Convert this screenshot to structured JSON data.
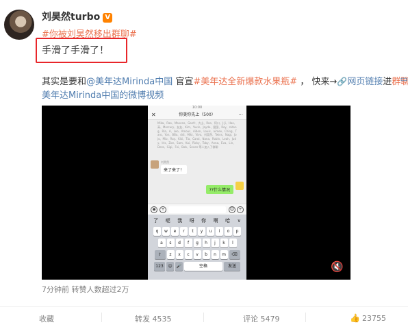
{
  "post": {
    "username": "刘昊然turbo",
    "verified_badge": "V",
    "topic": "#你被刘昊然移出群聊#",
    "text": "手滑了手滑了！",
    "body_line1_a": "其实是要和",
    "body_mention": "@美年达Mirinda中国",
    "body_line1_b": " 官宣",
    "body_topic": "#美年达全新爆款水果瓶#",
    "body_line1_c": " ， 快来→",
    "body_link_icon": "🔗",
    "body_link": "网页链接",
    "body_line1_d": "进",
    "body_group": "群聊",
    "body_line1_e": "！",
    "body_line2": "美年达Mirinda中国的微博视频",
    "meta": "7分钟前 转赞人数超过2万"
  },
  "video": {
    "mute_icon": "mute-icon",
    "phone": {
      "time": "10:00",
      "chat_title": "你美你先上（500）",
      "close": "✕",
      "more": "···",
      "notice": "Mika、Rao、Mavens、Ganfr、大山、Reo、阿川、J-Ji、Hao、高、Mercury、友友、Kim、Yuxin、Jayde、图图、Roy、zidong、Ria、A、Leo、Amour、Aiden、Louis、aimee、Ching、Taro、Yon、BBo、ddi、Miki、Vivo、刘昊然、Twins、Nagi、Jojo、Mio、Ray、Kiki、Tia、Carol、Nana、Robin、Leah、Judy、Iris、Zoe、Sam、Kai、Ricky、Toby、Anna、Eva、Lin、Dora、Gigi、Fei、Bob、Seven 等人加入了群聊",
      "sender": "刘昊然",
      "msg_left": "来了来了！",
      "msg_right": "??什么情况",
      "candidates": [
        "了",
        "呢",
        "我",
        "呀",
        "你",
        "啊",
        "哈",
        "∨"
      ],
      "keys_row1": [
        "q",
        "w",
        "e",
        "r",
        "t",
        "y",
        "u",
        "i",
        "o",
        "p"
      ],
      "keys_row2": [
        "a",
        "s",
        "d",
        "f",
        "g",
        "h",
        "j",
        "k",
        "l"
      ],
      "keys_row3": [
        "⇧",
        "z",
        "x",
        "c",
        "v",
        "b",
        "n",
        "m",
        "⌫"
      ],
      "key_123": "123",
      "key_emoji": "☺",
      "key_mic": "🎤",
      "key_space": "空格",
      "key_send": "发送"
    }
  },
  "actions": {
    "collect": "收藏",
    "repost": "转发 4535",
    "comment": "评论 5479",
    "like_icon": "thumb-up-icon",
    "like": "23755"
  },
  "colors": {
    "topic": "#eb7350",
    "link": "#507daf",
    "badge": "#ff8200",
    "highlight_box": "#e8262a"
  }
}
